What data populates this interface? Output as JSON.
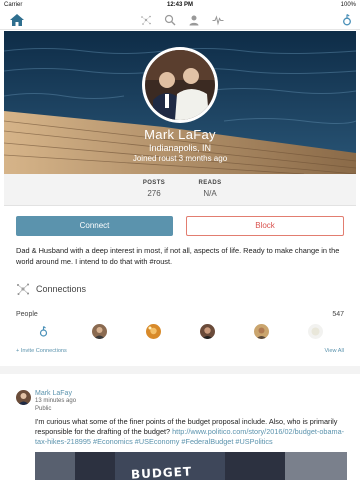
{
  "status_bar": {
    "carrier": "Carrier",
    "time": "12:43 PM",
    "battery": "100%"
  },
  "nav": {
    "icons": [
      "home-icon",
      "connections-icon",
      "search-icon",
      "people-icon",
      "activity-icon",
      "notification-icon"
    ]
  },
  "profile": {
    "name": "Mark LaFay",
    "location": "Indianapolis, IN",
    "joined": "Joined roust 3 months ago"
  },
  "stats": {
    "posts_label": "POSTS",
    "posts_value": "276",
    "reads_label": "READS",
    "reads_value": "N/A"
  },
  "actions": {
    "connect_label": "Connect",
    "block_label": "Block"
  },
  "bio": "Dad & Husband with a deep interest in most, if not all, aspects of life. Ready to make change in the world around me. I intend to do that with #roust.",
  "connections": {
    "title": "Connections",
    "people_label": "People",
    "people_count": "547",
    "invite_label": "+ Invite Connections",
    "view_all_label": "View All"
  },
  "post": {
    "author": "Mark LaFay",
    "time": "13 minutes ago",
    "visibility": "Public",
    "text": "I'm curious what some of the finer points of the budget proposal include. Also, who is primarily responsible for the drafting of the budget?",
    "link": "http://www.politico.com/story/2016/02/budget-obama-tax-hikes-218995",
    "hashtags": "#Economics #USEconomy #FederalBudget #USPolitics",
    "image_text": "BUDGET"
  },
  "colors": {
    "accent": "#5b93ad",
    "block": "#d9534f"
  }
}
